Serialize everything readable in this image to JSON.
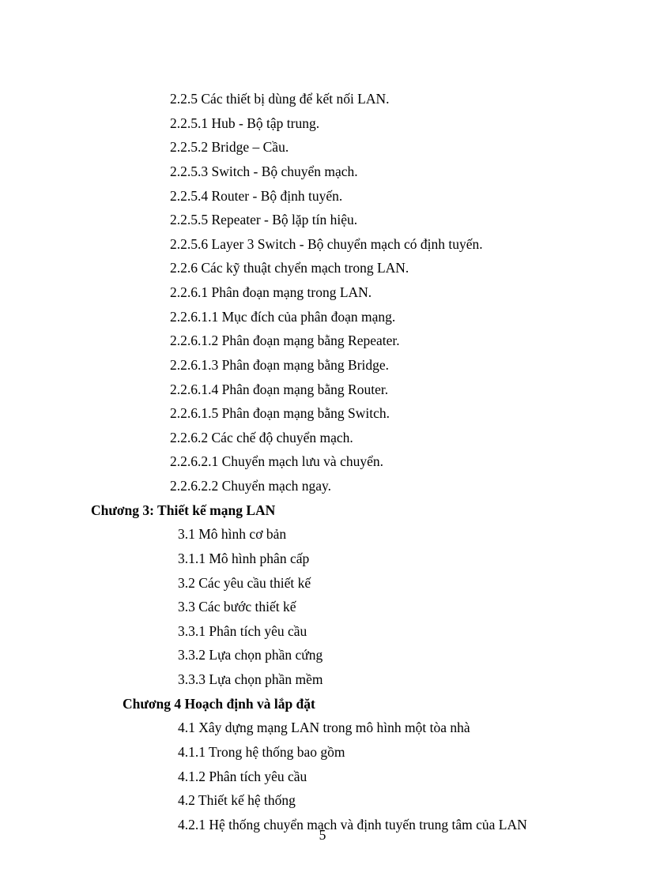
{
  "lines": [
    {
      "cls": "indent-1",
      "text": "2.2.5 Các thiết bị dùng để kết nối LAN."
    },
    {
      "cls": "indent-1",
      "text": "2.2.5.1 Hub - Bộ tập trung."
    },
    {
      "cls": "indent-1",
      "text": "2.2.5.2 Bridge – Cầu."
    },
    {
      "cls": "indent-1",
      "text": "2.2.5.3 Switch - Bộ chuyển mạch."
    },
    {
      "cls": "indent-1",
      "text": "2.2.5.4 Router - Bộ định tuyến."
    },
    {
      "cls": "indent-1",
      "text": "2.2.5.5 Repeater - Bộ lặp tín hiệu."
    },
    {
      "cls": "indent-1",
      "text": "2.2.5.6 Layer 3 Switch - Bộ chuyển mạch có định tuyến."
    },
    {
      "cls": "indent-1",
      "text": "2.2.6 Các kỹ thuật chyển mạch trong LAN."
    },
    {
      "cls": "indent-1",
      "text": "2.2.6.1 Phân đoạn mạng trong LAN."
    },
    {
      "cls": "indent-1",
      "text": "2.2.6.1.1 Mục đích của phân đoạn mạng."
    },
    {
      "cls": "indent-1",
      "text": "2.2.6.1.2 Phân đoạn mạng bằng Repeater."
    },
    {
      "cls": "indent-1",
      "text": "2.2.6.1.3 Phân đoạn mạng bằng Bridge."
    },
    {
      "cls": "indent-1",
      "text": "2.2.6.1.4 Phân đoạn mạng bằng Router."
    },
    {
      "cls": "indent-1",
      "text": "2.2.6.1.5 Phân đoạn mạng bằng Switch."
    },
    {
      "cls": "indent-1",
      "text": "2.2.6.2 Các chế độ chuyển mạch."
    },
    {
      "cls": "indent-1",
      "text": "2.2.6.2.1 Chuyển mạch lưu và chuyển."
    },
    {
      "cls": "indent-1",
      "text": "2.2.6.2.2 Chuyển mạch ngay."
    },
    {
      "cls": "indent-h",
      "text": "Chương 3: Thiết kế mạng LAN"
    },
    {
      "cls": "indent-2",
      "text": "3.1 Mô hình cơ bản"
    },
    {
      "cls": "indent-2",
      "text": "3.1.1 Mô hình phân cấp"
    },
    {
      "cls": "indent-2",
      "text": "3.2 Các yêu cầu thiết kế"
    },
    {
      "cls": "indent-2",
      "text": "3.3 Các bước thiết kế"
    },
    {
      "cls": "indent-2",
      "text": "3.3.1 Phân tích yêu cầu"
    },
    {
      "cls": "indent-2",
      "text": "3.3.2 Lựa chọn phần cứng"
    },
    {
      "cls": "indent-2",
      "text": "3.3.3 Lựa chọn phần mềm"
    },
    {
      "cls": "indent-h2",
      "text": "Chương 4 Hoạch định và lắp đặt"
    },
    {
      "cls": "indent-2",
      "text": "4.1 Xây dựng mạng LAN trong mô hình một tòa nhà"
    },
    {
      "cls": "indent-2",
      "text": "4.1.1 Trong hệ thống bao gồm"
    },
    {
      "cls": "indent-2",
      "text": "4.1.2 Phân tích yêu cầu"
    },
    {
      "cls": "indent-2",
      "text": "4.2 Thiết kế hệ thống"
    },
    {
      "cls": "indent-2",
      "text": "4.2.1 Hệ thống chuyển mạch và định tuyến trung tâm của LAN"
    }
  ],
  "page_number": "5"
}
